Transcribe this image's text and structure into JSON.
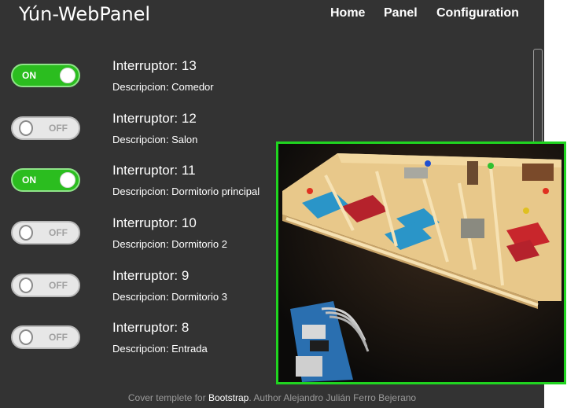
{
  "brand": "Yún-WebPanel",
  "nav": [
    {
      "label": "Home"
    },
    {
      "label": "Panel"
    },
    {
      "label": "Configuration"
    }
  ],
  "switches": [
    {
      "state": "ON",
      "title": "Interruptor: 13",
      "description": "Descripcion: Comedor"
    },
    {
      "state": "OFF",
      "title": "Interruptor: 12",
      "description": "Descripcion: Salon"
    },
    {
      "state": "ON",
      "title": "Interruptor: 11",
      "description": "Descripcion: Dormitorio principal"
    },
    {
      "state": "OFF",
      "title": "Interruptor: 10",
      "description": "Descripcion: Dormitorio 2"
    },
    {
      "state": "OFF",
      "title": "Interruptor: 9",
      "description": "Descripcion: Dormitorio 3"
    },
    {
      "state": "OFF",
      "title": "Interruptor: 8",
      "description": "Descripcion: Entrada"
    }
  ],
  "footer": {
    "prefix": "Cover templete for ",
    "link": "Bootstrap",
    "suffix": ". Author Alejandro Julián Ferro Bejerano"
  },
  "colors": {
    "background": "#333333",
    "toggle_on": "#2bbd1f",
    "toggle_off": "#e7e7e7",
    "photo_border": "#20d420"
  }
}
